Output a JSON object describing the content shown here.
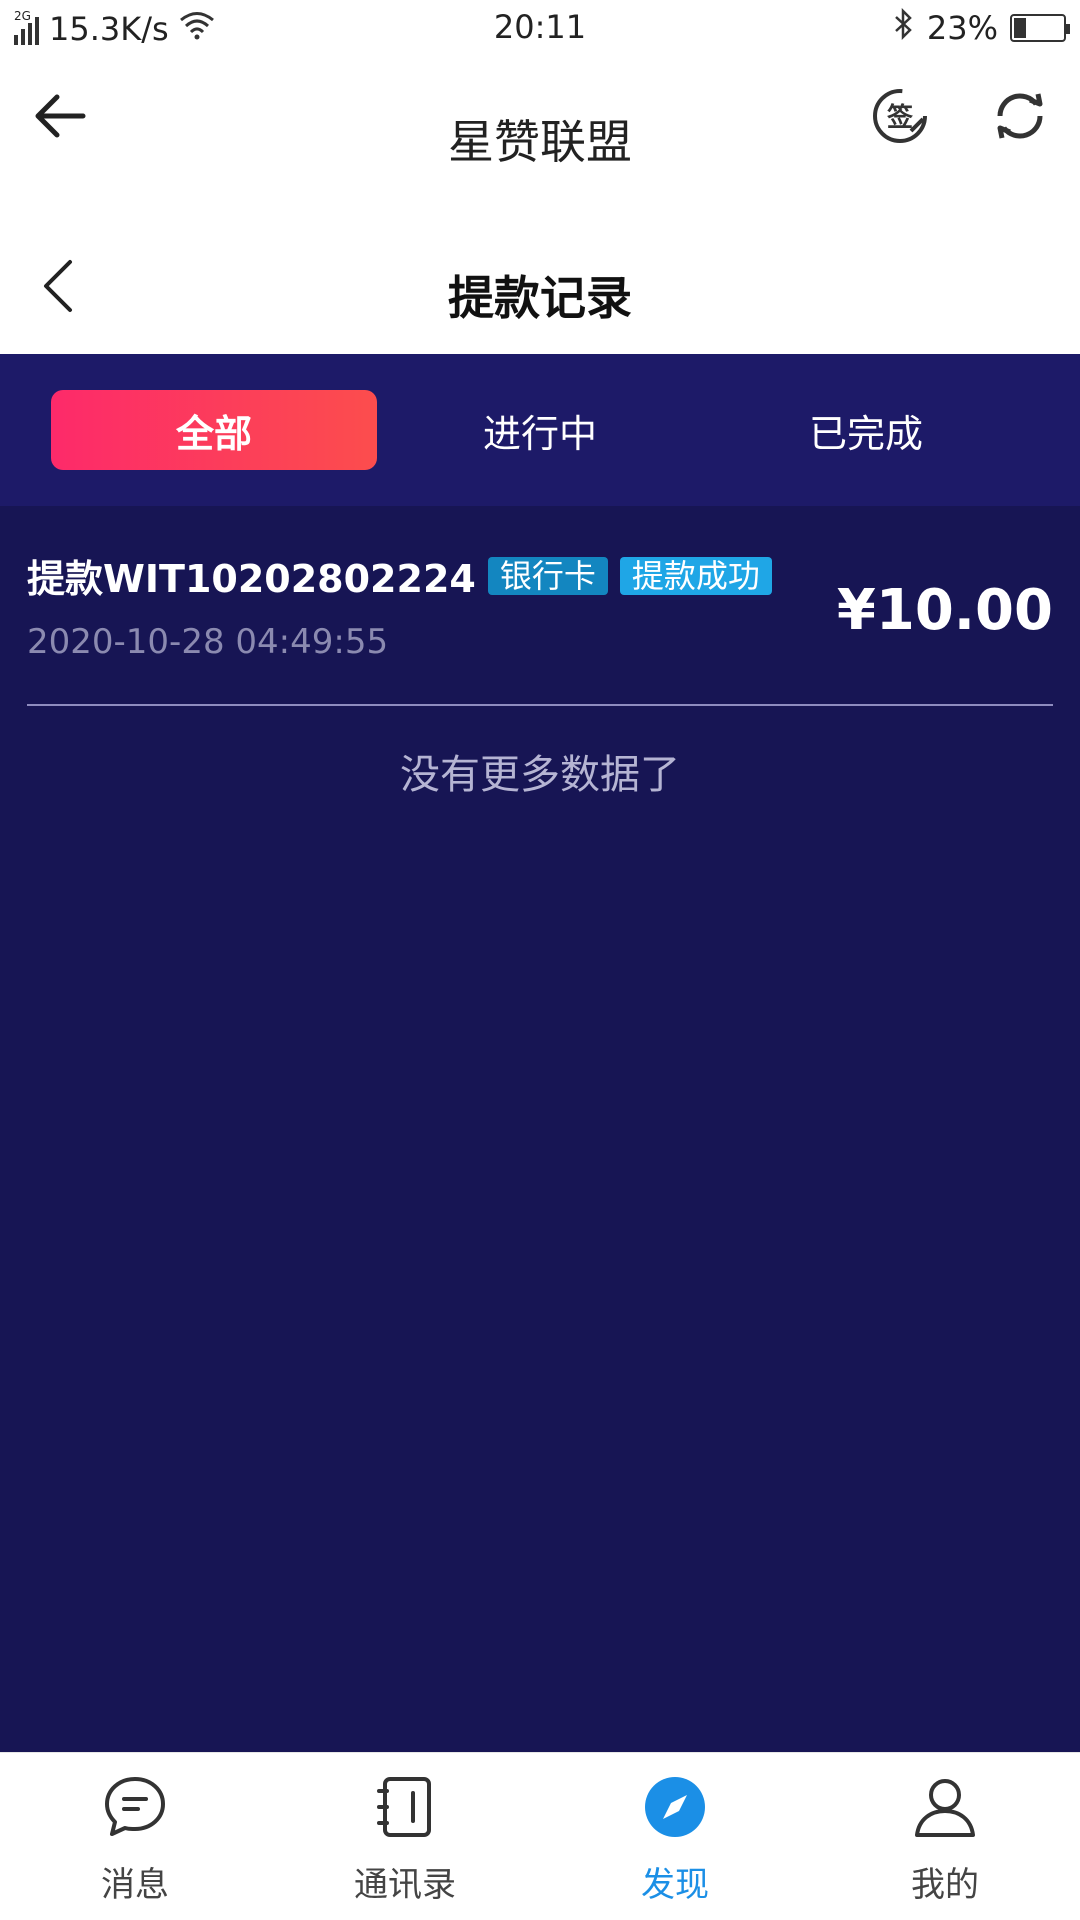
{
  "status_bar": {
    "signal": "2G",
    "network_speed": "15.3K/s",
    "time": "20:11",
    "battery": "23%",
    "battery_level": 0.23
  },
  "app_header": {
    "title": "星赞联盟",
    "sign_icon_text": "签"
  },
  "sub_header": {
    "title": "提款记录"
  },
  "tabs": [
    {
      "label": "全部",
      "active": true
    },
    {
      "label": "进行中",
      "active": false
    },
    {
      "label": "已完成",
      "active": false
    }
  ],
  "records": [
    {
      "title": "提款WIT10202802224",
      "method_badge": "银行卡",
      "status_badge": "提款成功",
      "time": "2020-10-28 04:49:55",
      "amount": "¥10.00"
    }
  ],
  "no_more_text": "没有更多数据了",
  "bottom_nav": [
    {
      "label": "消息",
      "icon": "message-icon",
      "active": false
    },
    {
      "label": "通讯录",
      "icon": "contacts-icon",
      "active": false
    },
    {
      "label": "发现",
      "icon": "compass-icon",
      "active": true
    },
    {
      "label": "我的",
      "icon": "profile-icon",
      "active": false
    }
  ],
  "colors": {
    "content_bg": "#171554",
    "tabs_bg": "#1d1a68",
    "tab_active_start": "#fd2a6a",
    "tab_active_end": "#fc4d4d",
    "badge_bank": "#1386c0",
    "badge_success": "#1fa6e6",
    "nav_active": "#1b8fe6"
  }
}
